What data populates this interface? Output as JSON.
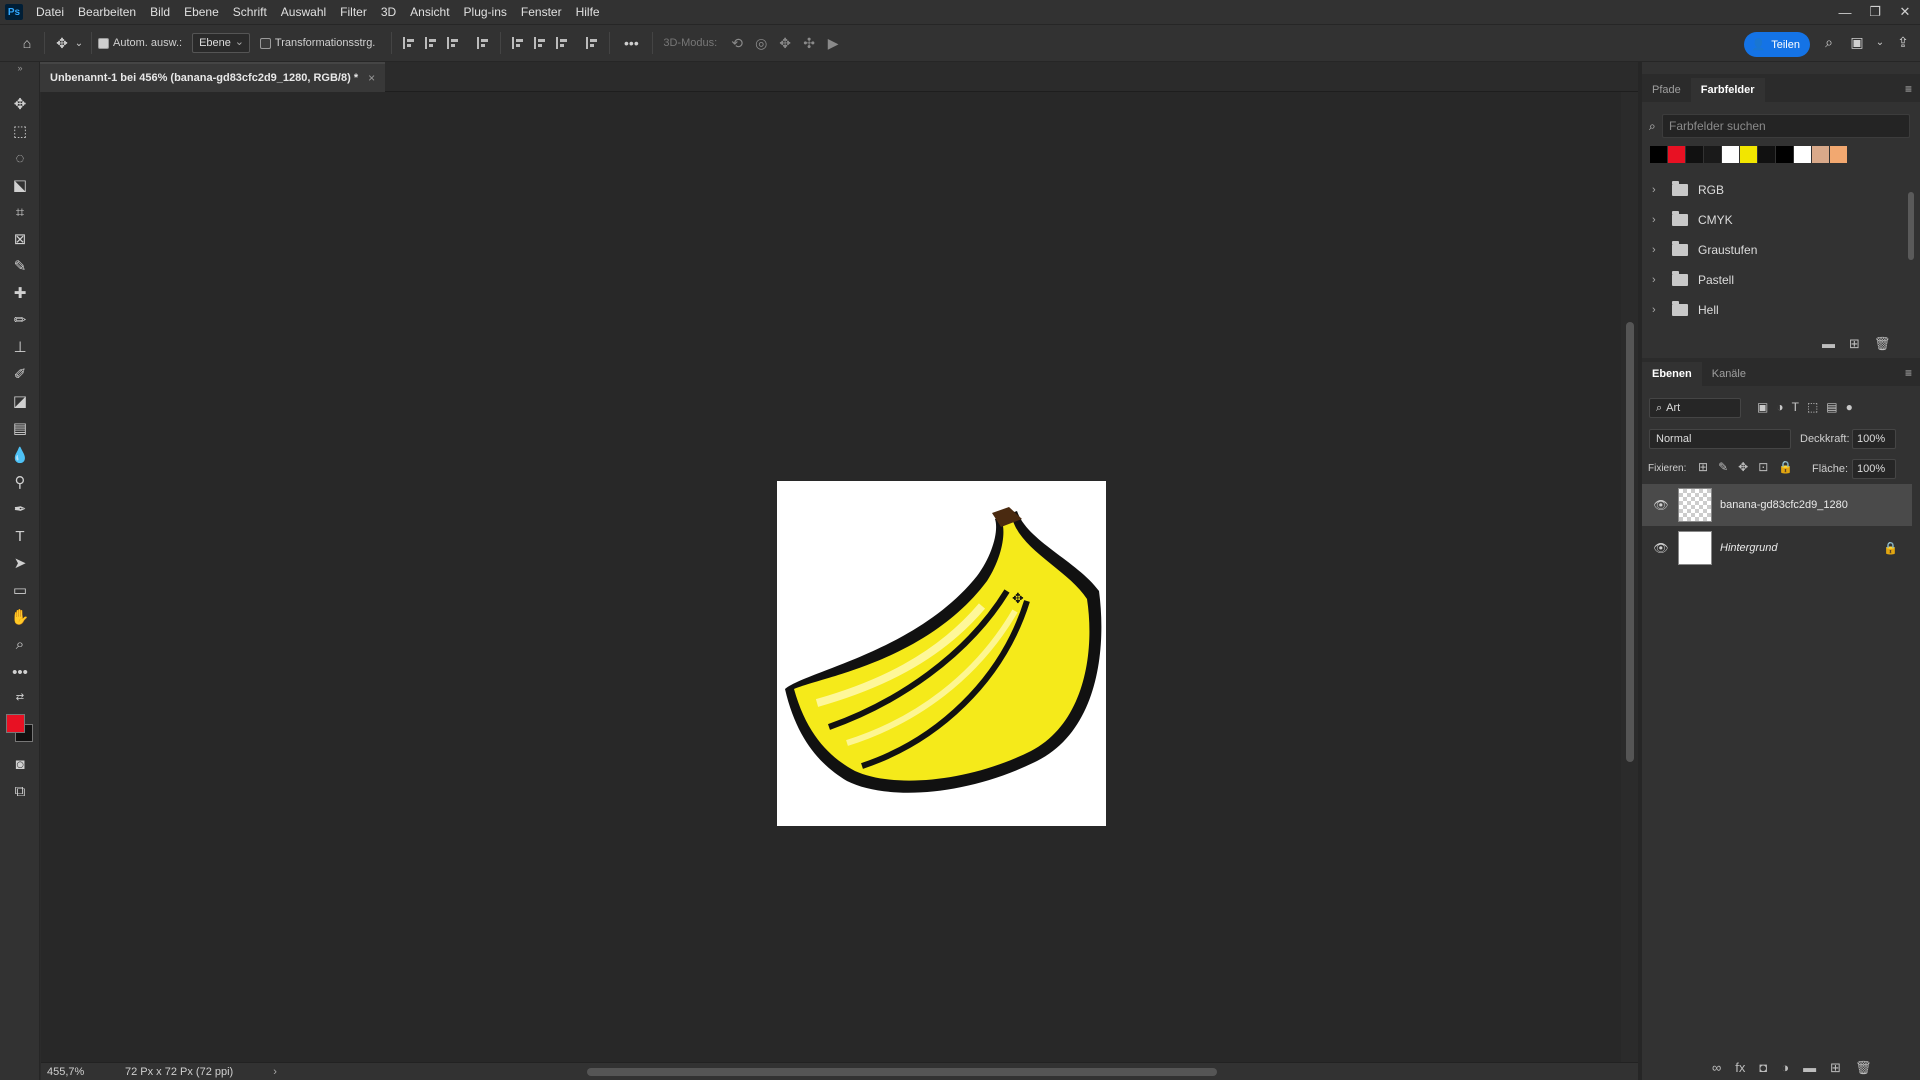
{
  "app": {
    "logo": "Ps"
  },
  "menu": [
    "Datei",
    "Bearbeiten",
    "Bild",
    "Ebene",
    "Schrift",
    "Auswahl",
    "Filter",
    "3D",
    "Ansicht",
    "Plug-ins",
    "Fenster",
    "Hilfe"
  ],
  "options": {
    "auto_select_label": "Autom. ausw.:",
    "auto_select_value": "Ebene",
    "transform_label": "Transformationsstrg.",
    "more": "•••",
    "mode_3d_label": "3D-Modus:"
  },
  "share": {
    "label": "Teilen"
  },
  "document": {
    "tab_title": "Unbenannt-1 bei 456% (banana-gd83cfc2d9_1280, RGB/8) *",
    "close": "×"
  },
  "status": {
    "zoom": "455,7%",
    "size": "72 Px x 72 Px (72 ppi)",
    "arrow": "›"
  },
  "swatches_panel": {
    "tabs": [
      "Pfade",
      "Farbfelder"
    ],
    "active_tab": 1,
    "search_placeholder": "Farbfelder suchen",
    "colors": [
      "#000000",
      "#e81123",
      "#111111",
      "#1a1a1a",
      "#ffffff",
      "#f2e600",
      "#111111",
      "#000000",
      "#ffffff",
      "#d9a98a",
      "#f2a870"
    ],
    "groups": [
      "RGB",
      "CMYK",
      "Graustufen",
      "Pastell",
      "Hell"
    ]
  },
  "layers_panel": {
    "tabs": [
      "Ebenen",
      "Kanäle"
    ],
    "active_tab": 0,
    "filter_label": "Art",
    "blend_mode": "Normal",
    "opacity_label": "Deckkraft:",
    "opacity_value": "100%",
    "lock_label": "Fixieren:",
    "fill_label": "Fläche:",
    "fill_value": "100%",
    "layers": [
      {
        "name": "banana-gd83cfc2d9_1280",
        "visible": true,
        "selected": true,
        "locked": false
      },
      {
        "name": "Hintergrund",
        "visible": true,
        "selected": false,
        "locked": true
      }
    ]
  },
  "colors": {
    "foreground": "#e81123",
    "background": "#111111",
    "accent": "#1473e6"
  }
}
